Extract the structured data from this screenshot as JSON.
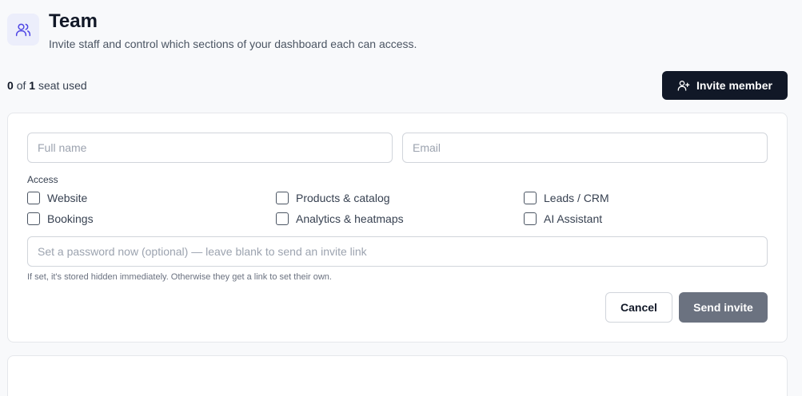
{
  "header": {
    "title": "Team",
    "subtitle": "Invite staff and control which sections of your dashboard each can access.",
    "icon": "users-icon"
  },
  "seats": {
    "used": "0",
    "of_label": "of",
    "total": "1",
    "suffix": "seat used"
  },
  "invite_button": {
    "label": "Invite member",
    "icon": "user-plus-icon"
  },
  "form": {
    "full_name_placeholder": "Full name",
    "email_placeholder": "Email",
    "access_label": "Access",
    "access_options": [
      {
        "label": "Website",
        "checked": false
      },
      {
        "label": "Bookings",
        "checked": false
      },
      {
        "label": "Products & catalog",
        "checked": false
      },
      {
        "label": "Analytics & heatmaps",
        "checked": false
      },
      {
        "label": "Leads / CRM",
        "checked": false
      },
      {
        "label": "AI Assistant",
        "checked": false
      }
    ],
    "password_placeholder": "Set a password now (optional) — leave blank to send an invite link",
    "password_hint": "If set, it's stored hidden immediately. Otherwise they get a link to set their own.",
    "cancel_label": "Cancel",
    "send_label": "Send invite"
  },
  "colors": {
    "primary": "#111827",
    "disabled_button": "#6b7280",
    "icon_accent": "#4f46e5",
    "icon_bg": "#eceefb"
  }
}
